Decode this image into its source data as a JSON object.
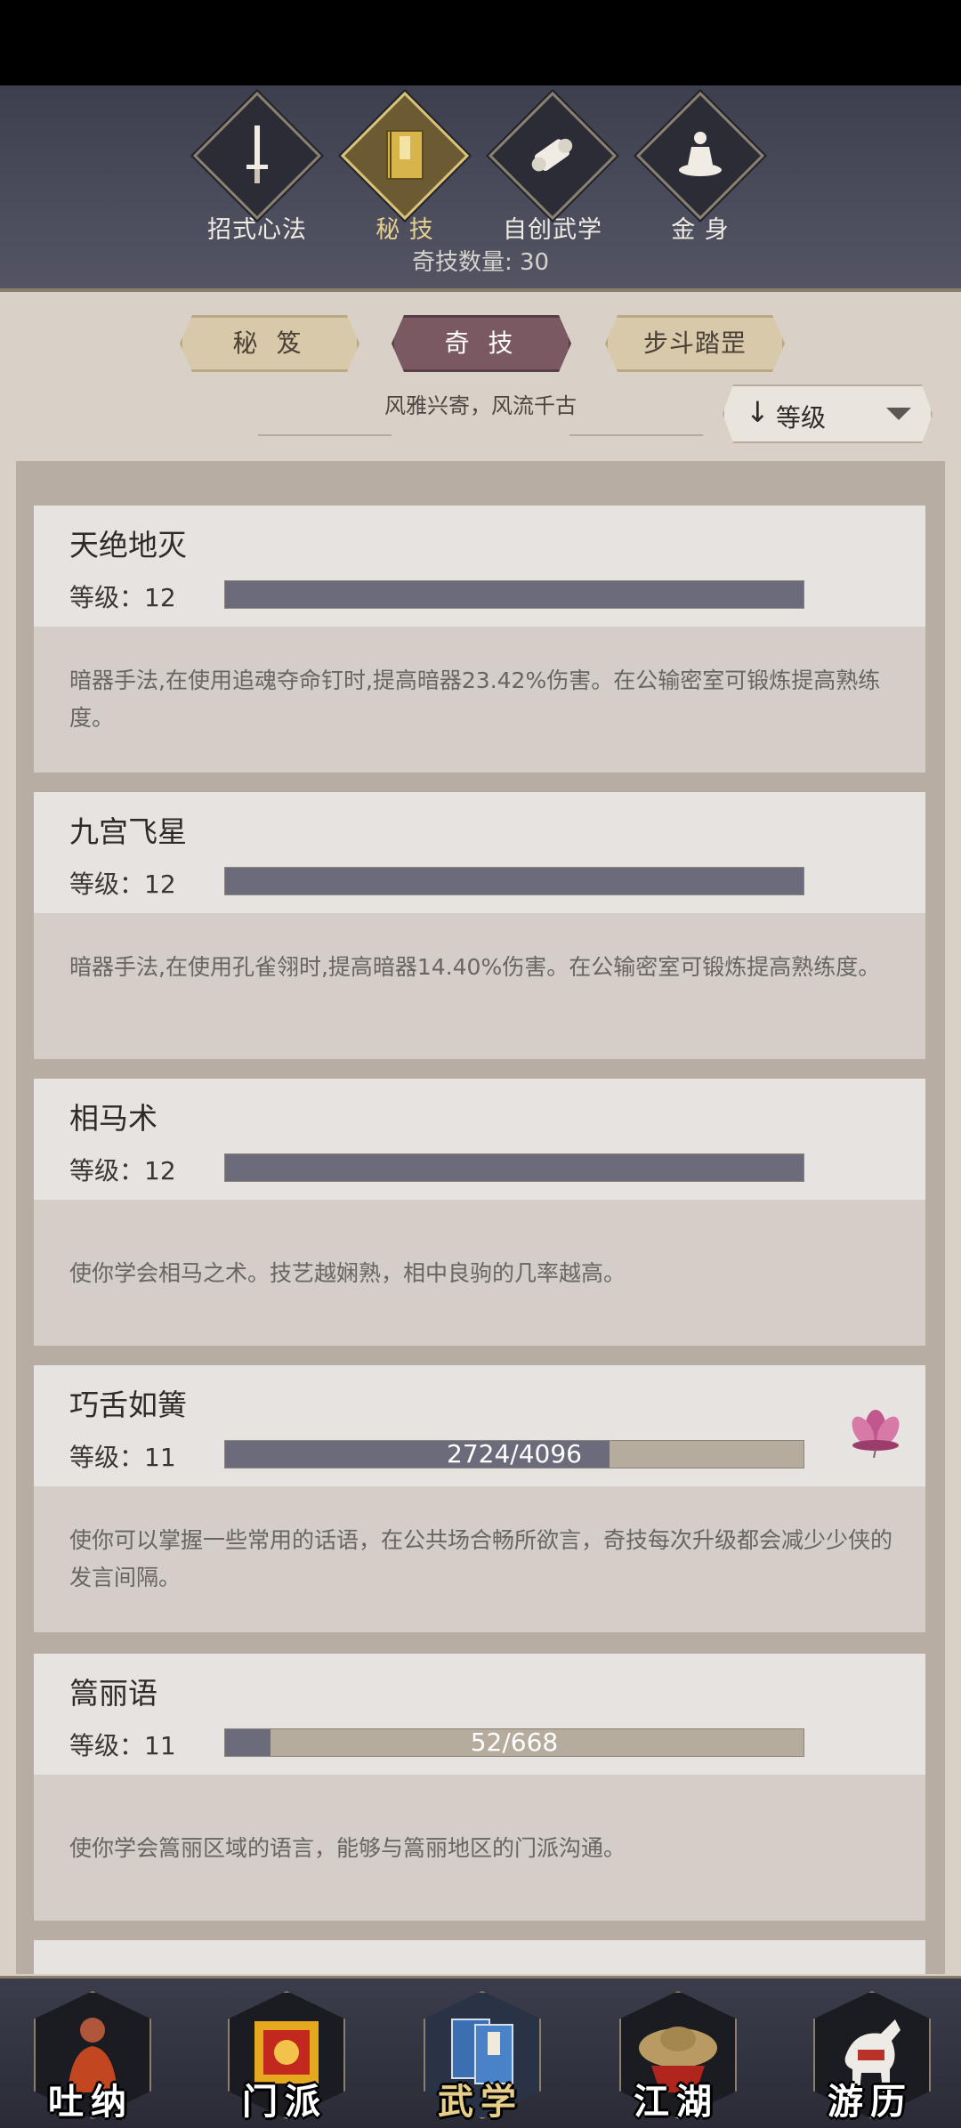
{
  "top_tabs": [
    {
      "label": "招式心法",
      "icon": "sword-icon",
      "active": false
    },
    {
      "label": "秘 技",
      "icon": "book-icon",
      "active": true
    },
    {
      "label": "自创武学",
      "icon": "scroll-icon",
      "active": false
    },
    {
      "label": "金 身",
      "icon": "meditation-icon",
      "active": false
    }
  ],
  "skill_count": "奇技数量: 30",
  "sub_tabs": [
    {
      "label": "秘 笈",
      "active": false
    },
    {
      "label": "奇 技",
      "active": true
    },
    {
      "label": "步斗踏罡",
      "active": false
    }
  ],
  "motto": "风雅兴寄，风流千古",
  "sort": {
    "arrow": "↓",
    "label": "等级"
  },
  "skills": [
    {
      "name": "天绝地灭",
      "level": "等级：12",
      "progress_text": "",
      "progress": 1.0,
      "desc": "暗器手法,在使用追魂夺命钉时,提高暗器23.42%伤害。在公输密室可锻炼提高熟练度。"
    },
    {
      "name": "九宫飞星",
      "level": "等级：12",
      "progress_text": "",
      "progress": 1.0,
      "desc": "暗器手法,在使用孔雀翎时,提高暗器14.40%伤害。在公输密室可锻炼提高熟练度。"
    },
    {
      "name": "相马术",
      "level": "等级：12",
      "progress_text": "",
      "progress": 1.0,
      "desc": "使你学会相马之术。技艺越娴熟，相中良驹的几率越高。"
    },
    {
      "name": "巧舌如簧",
      "level": "等级：11",
      "progress_text": "2724/4096",
      "progress": 0.665,
      "desc": "使你可以掌握一些常用的话语，在公共场合畅所欲言，奇技每次升级都会减少少侠的发言间隔。"
    },
    {
      "name": "篙丽语",
      "level": "等级：11",
      "progress_text": "52/668",
      "progress": 0.078,
      "desc": "使你学会篙丽区域的语言，能够与篙丽地区的门派沟通。"
    }
  ],
  "bottom_nav": [
    {
      "label": "吐纳",
      "icon": "monk-icon",
      "active": false
    },
    {
      "label": "门派",
      "icon": "banner-icon",
      "active": false
    },
    {
      "label": "武学",
      "icon": "books-icon",
      "active": true
    },
    {
      "label": "江湖",
      "icon": "straw-hat-icon",
      "active": false
    },
    {
      "label": "游历",
      "icon": "horse-icon",
      "active": false
    }
  ],
  "colors": {
    "accent_gold": "#e6cf8e",
    "active_tab": "#7b5962",
    "progress_fill": "#6c6b7c"
  }
}
